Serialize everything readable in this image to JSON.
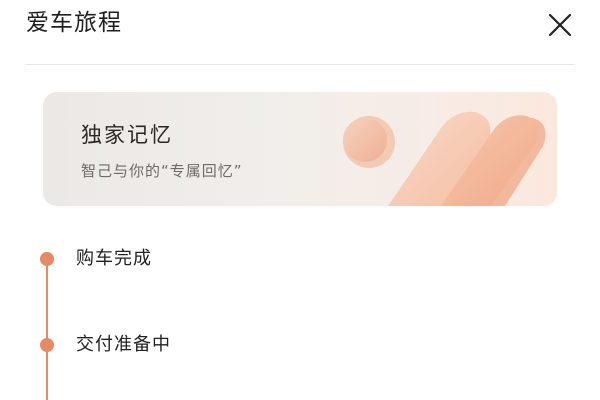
{
  "header": {
    "title": "爱车旅程",
    "close_icon": "close-icon"
  },
  "memory_card": {
    "title": "独家记忆",
    "subtitle": "智己与你的“专属回忆”",
    "decoration_icon": "rounded-stripes-graphic"
  },
  "timeline": {
    "items": [
      {
        "label": "购车完成"
      },
      {
        "label": "交付准备中"
      }
    ]
  },
  "colors": {
    "accent": "#e58a65",
    "card_gradient_start": "#ebe8e6",
    "card_gradient_end": "#fbe8dd",
    "divider": "#e7e7e7"
  }
}
